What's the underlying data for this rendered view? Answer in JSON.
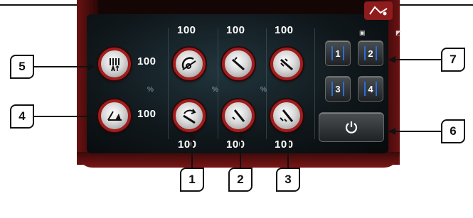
{
  "screen": {
    "left_values": [
      "100",
      "100"
    ],
    "top_values": [
      "100",
      "100",
      "100"
    ],
    "bottom_values": [
      "100",
      "100",
      "100"
    ],
    "percent_label": "%",
    "buttons": [
      "1",
      "2",
      "3",
      "4"
    ]
  },
  "callouts": [
    "1",
    "2",
    "3",
    "4",
    "5",
    "6",
    "7"
  ],
  "icons": {
    "row1": [
      "temperature-icon",
      "arc-dial-icon",
      "torch-icon",
      "torch-icon"
    ],
    "row2": [
      "angle-icon",
      "dial-arrow-icon",
      "torch-icon",
      "torch-icon"
    ],
    "power": "power-icon"
  },
  "colors": {
    "accent": "#a21d1d",
    "button_bracket": "#2a6cd9"
  }
}
